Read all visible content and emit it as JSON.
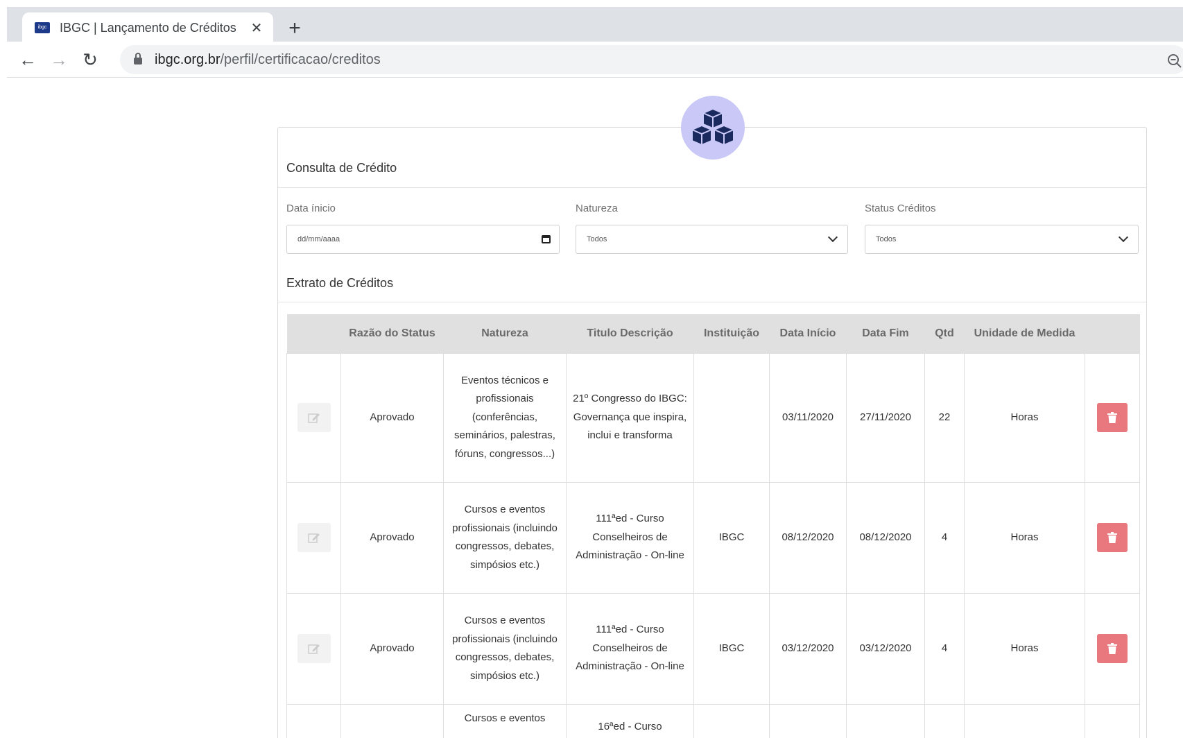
{
  "browser": {
    "tab_title": "IBGC | Lançamento de Créditos",
    "favicon_text": "ibgc",
    "close_glyph": "✕",
    "newtab_glyph": "+",
    "url_host": "ibgc.org.br",
    "url_path": "/perfil/certificacao/creditos",
    "back_glyph": "←",
    "forward_glyph": "→",
    "reload_glyph": "↻"
  },
  "consulta": {
    "title": "Consulta de Crédito",
    "data_inicio": {
      "label": "Data ínicio",
      "placeholder": "dd/mm/aaaa"
    },
    "natureza": {
      "label": "Natureza",
      "value": "Todos"
    },
    "status": {
      "label": "Status Créditos",
      "value": "Todos"
    }
  },
  "extrato": {
    "title": "Extrato de Créditos",
    "columns": [
      "",
      "Razão do Status",
      "Natureza",
      "Titulo Descrição",
      "Instituição",
      "Data Início",
      "Data Fim",
      "Qtd",
      "Unidade de Medida",
      ""
    ],
    "rows": [
      {
        "razao": "Aprovado",
        "natureza": "Eventos técnicos e profissionais (conferências, seminários, palestras, fóruns, congressos...)",
        "titulo": "21º Congresso do IBGC: Governança que inspira, inclui e transforma",
        "instituicao": "",
        "data_inicio": "03/11/2020",
        "data_fim": "27/11/2020",
        "qtd": "22",
        "unidade": "Horas"
      },
      {
        "razao": "Aprovado",
        "natureza": "Cursos e eventos profissionais (incluindo congressos, debates, simpósios etc.)",
        "titulo": "111ªed - Curso Conselheiros de Administração - On-line",
        "instituicao": "IBGC",
        "data_inicio": "08/12/2020",
        "data_fim": "08/12/2020",
        "qtd": "4",
        "unidade": "Horas"
      },
      {
        "razao": "Aprovado",
        "natureza": "Cursos e eventos profissionais (incluindo congressos, debates, simpósios etc.)",
        "titulo": "111ªed - Curso Conselheiros de Administração - On-line",
        "instituicao": "IBGC",
        "data_inicio": "03/12/2020",
        "data_fim": "03/12/2020",
        "qtd": "4",
        "unidade": "Horas"
      },
      {
        "razao": "",
        "natureza": "Cursos e eventos",
        "titulo": "16ªed - Curso",
        "instituicao": "",
        "data_inicio": "",
        "data_fim": "",
        "qtd": "",
        "unidade": ""
      }
    ]
  },
  "colors": {
    "delete": "#e8777e",
    "badge": "#c9c8f7",
    "badge_icon": "#1a2a5e"
  }
}
